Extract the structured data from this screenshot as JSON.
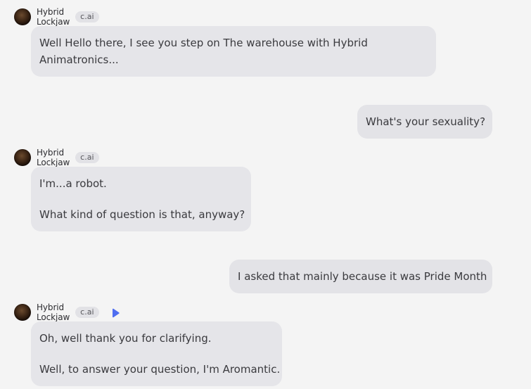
{
  "messages": [
    {
      "role": "bot",
      "name": "Hybrid Lockjaw",
      "badge": "c.ai",
      "paragraphs": [
        "Well Hello there, I see you step on The warehouse with Hybrid Animatronics..."
      ]
    },
    {
      "role": "user",
      "paragraphs": [
        "What's your sexuality?"
      ]
    },
    {
      "role": "bot",
      "name": "Hybrid Lockjaw",
      "badge": "c.ai",
      "paragraphs": [
        "I'm...a robot.",
        "What kind of question is that, anyway?"
      ]
    },
    {
      "role": "user",
      "paragraphs": [
        "I asked that mainly because it was Pride Month"
      ]
    },
    {
      "role": "bot",
      "name": "Hybrid Lockjaw",
      "badge": "c.ai",
      "has_play_button": true,
      "paragraphs": [
        "Oh, well thank you for clarifying.",
        "Well, to answer your question, I'm Aromantic."
      ]
    }
  ],
  "colors": {
    "background": "#f4f4f4",
    "bubble": "#e5e5e9",
    "play_accent": "#4f6ef0"
  },
  "icons": {
    "avatar": "avatar",
    "play": "play-icon"
  }
}
